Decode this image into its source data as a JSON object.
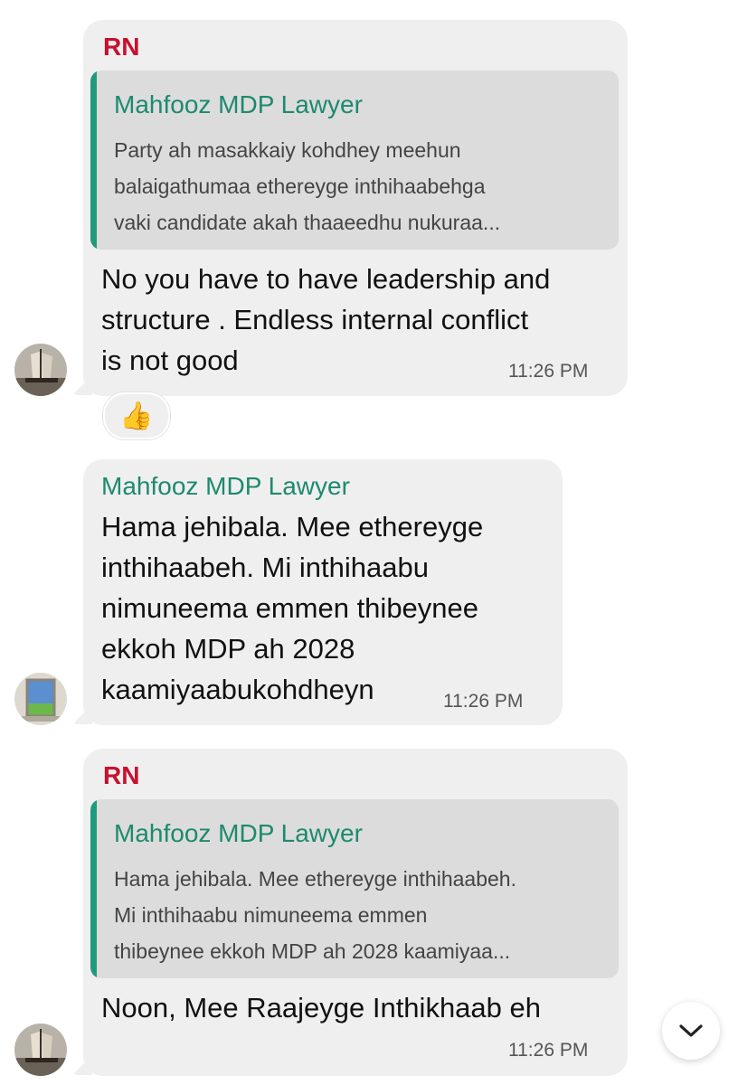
{
  "messages": [
    {
      "sender": "RN",
      "quote": {
        "name": "Mahfooz MDP Lawyer",
        "lines": [
          "Party ah masakkaiy kohdhey meehun",
          "balaigathumaa ethereyge inthihaabehga",
          "vaki candidate akah thaaeedhu nukuraa..."
        ]
      },
      "lines": [
        "No you have to have leadership and",
        "structure . Endless internal conflict",
        "is not good"
      ],
      "time": "11:26 PM",
      "reaction": "👍"
    },
    {
      "sender": "Mahfooz MDP Lawyer",
      "lines": [
        "Hama jehibala. Mee ethereyge",
        "inthihaabeh. Mi inthihaabu",
        "nimuneema emmen thibeynee",
        "ekkoh MDP ah 2028",
        "kaamiyaabukohdheyn"
      ],
      "time": "11:26 PM"
    },
    {
      "sender": "RN",
      "quote": {
        "name": "Mahfooz MDP Lawyer",
        "lines": [
          "Hama jehibala. Mee ethereyge inthihaabeh.",
          "Mi inthihaabu nimuneema emmen",
          "thibeynee ekkoh MDP ah 2028 kaamiyaa..."
        ]
      },
      "lines": [
        "Noon, Mee Raajeyge Inthikhaab eh"
      ],
      "time": "11:26 PM"
    }
  ],
  "colors": {
    "bubble": "#efefef",
    "quote_bg": "#dcdcdc",
    "quote_bar": "#1f9a7c",
    "sender_rn": "#c8102e",
    "sender_mdp": "#1d8a6e"
  },
  "icons": {
    "scroll_down": "chevron-down-icon"
  }
}
